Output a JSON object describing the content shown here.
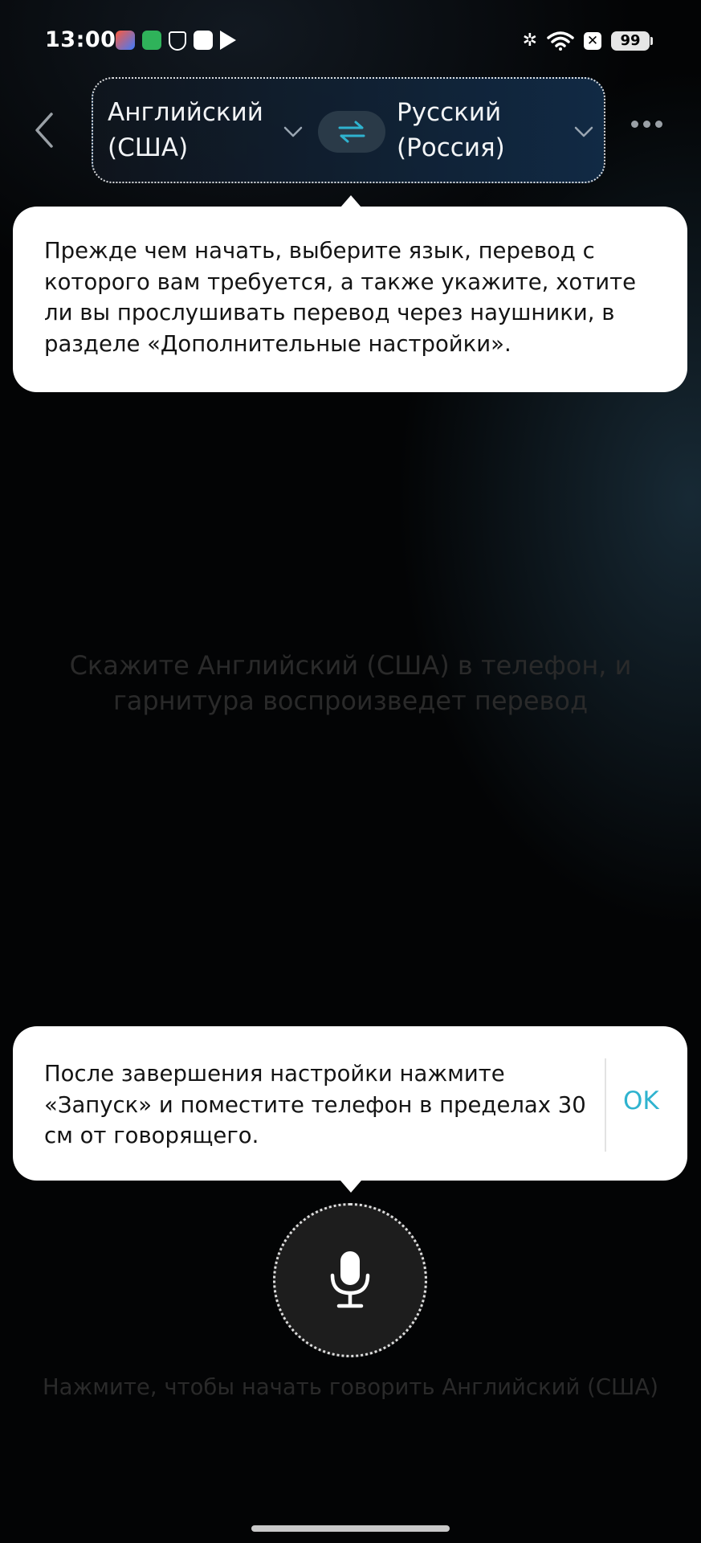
{
  "status_bar": {
    "time": "13:00",
    "notification_icons": [
      "app-star-icon",
      "app-green-icon",
      "shield-icon",
      "app-white-icon",
      "play-store-icon"
    ],
    "system_icons": [
      "bluetooth-icon",
      "wifi-icon",
      "no-sim-icon",
      "battery-icon"
    ],
    "battery_level": "99"
  },
  "header": {
    "back_icon": "chevron-left-icon",
    "source_language": "Английский (США)",
    "target_language": "Русский (Россия)",
    "swap_icon": "swap-arrows-icon",
    "more_icon": "more-dots-icon",
    "accent_color": "#2fb3cf"
  },
  "popover_top": {
    "text": "Прежде чем начать, выберите язык, перевод с которого вам требуется, а также укажите, хотите ли вы прослушивать перевод через наушники, в разделе «Дополнительные настройки»."
  },
  "main": {
    "hint": "Скажите Английский (США) в телефон, и гарнитура воспроизведет перевод"
  },
  "popover_bottom": {
    "text": "После завершения настройки нажмите «Запуск» и поместите телефон в пределах 30 см от говорящего.",
    "ok_label": "OK"
  },
  "mic": {
    "icon": "microphone-icon",
    "hint": "Нажмите, чтобы начать говорить Английский (США)"
  }
}
